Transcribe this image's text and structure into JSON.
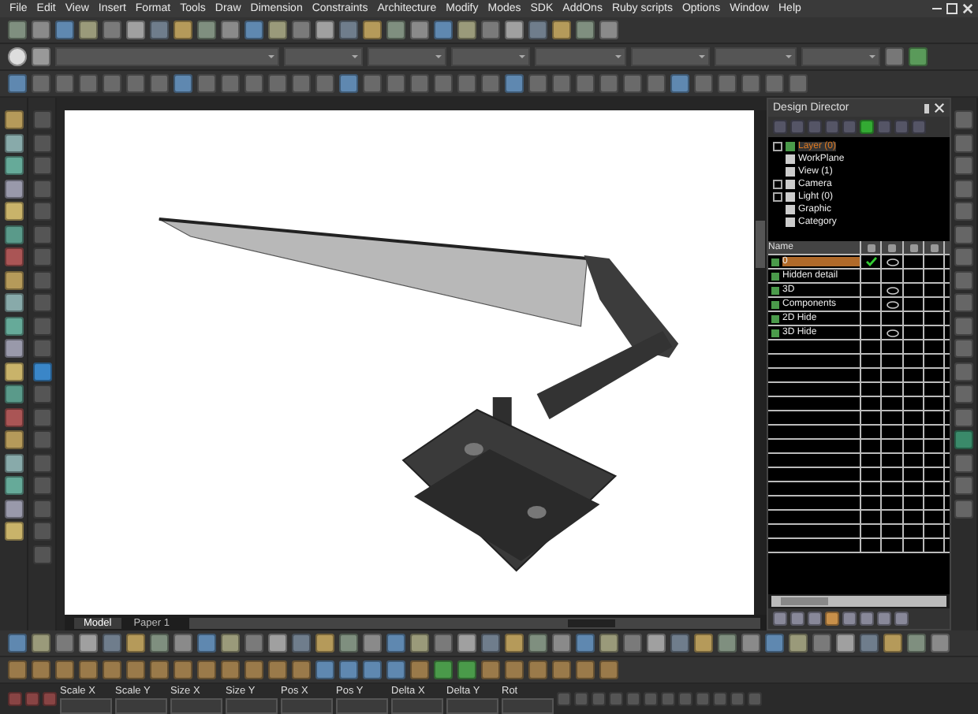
{
  "menu_bar": [
    "File",
    "Edit",
    "View",
    "Insert",
    "Format",
    "Tools",
    "Draw",
    "Dimension",
    "Constraints",
    "Architecture",
    "Modify",
    "Modes",
    "SDK",
    "AddOns",
    "Ruby scripts",
    "Options",
    "Window",
    "Help"
  ],
  "layout_tabs": [
    {
      "label": "Model",
      "selected": true
    },
    {
      "label": "Paper 1",
      "selected": false
    }
  ],
  "design_director": {
    "title": "Design Director",
    "tree": [
      {
        "label": "Layer (0)",
        "kind": "node",
        "selected": true
      },
      {
        "label": "WorkPlane",
        "kind": "leaf",
        "selected": false
      },
      {
        "label": "View (1)",
        "kind": "leaf",
        "selected": false
      },
      {
        "label": "Camera",
        "kind": "node",
        "selected": false
      },
      {
        "label": "Light (0)",
        "kind": "node",
        "selected": false
      },
      {
        "label": "Graphic",
        "kind": "leaf",
        "selected": false
      },
      {
        "label": "Category",
        "kind": "leaf",
        "selected": false
      }
    ],
    "table": {
      "name_column": "Name",
      "rows": [
        {
          "name": "0",
          "selected": true,
          "active": true,
          "visible": true
        },
        {
          "name": "Hidden detail",
          "selected": false,
          "active": false,
          "visible": false
        },
        {
          "name": "3D",
          "selected": false,
          "active": false,
          "visible": true
        },
        {
          "name": "Components",
          "selected": false,
          "active": false,
          "visible": true
        },
        {
          "name": "2D Hide",
          "selected": false,
          "active": false,
          "visible": false
        },
        {
          "name": "3D Hide",
          "selected": false,
          "active": false,
          "visible": true
        }
      ]
    }
  },
  "transform_bar": [
    "Scale X",
    "Scale Y",
    "Size X",
    "Size Y",
    "Pos X",
    "Pos Y",
    "Delta X",
    "Delta Y",
    "Rot"
  ]
}
